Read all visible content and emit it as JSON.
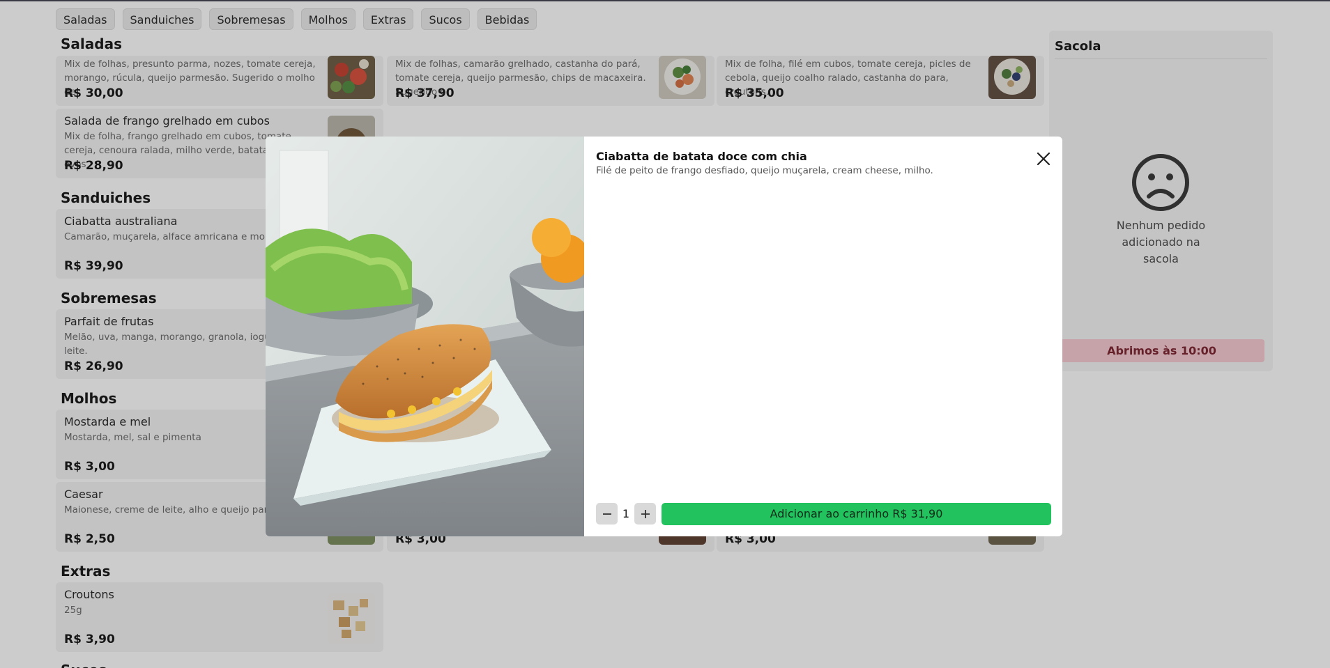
{
  "tabs": [
    "Saladas",
    "Sanduiches",
    "Sobremesas",
    "Molhos",
    "Extras",
    "Sucos",
    "Bebidas"
  ],
  "sections": {
    "saladas": "Saladas",
    "sanduiches": "Sanduiches",
    "sobremesas": "Sobremesas",
    "molhos": "Molhos",
    "extras": "Extras",
    "sucos": "Sucos"
  },
  "products": {
    "salada_parma": {
      "desc": "Mix de folhas, presunto parma, nozes, tomate cereja, morango, rúcula, queijo parmesão. Sugerido o molho de",
      "price": "R$ 30,00"
    },
    "salada_camarao": {
      "desc": "Mix de folhas, camarão grelhado, castanha do pará, tomate cereja, queijo parmesão, chips de macaxeira. Sugerido o",
      "price": "R$ 37,90"
    },
    "salada_file": {
      "desc": "Mix de folha, filé em cubos, tomate cereja, picles de cebola, queijo coalho ralado, castanha do para, croutons.",
      "price": "R$ 35,00"
    },
    "salada_frango": {
      "name": "Salada de frango grelhado em cubos",
      "desc": "Mix de folha, frango grelhado em cubos, tomate cereja, cenoura ralada, milho verde, batata palha, ovos",
      "price": "R$ 28,90"
    },
    "ciabatta_australiana": {
      "name": "Ciabatta australiana",
      "desc": "Camarão, muçarela, alface amricana e molho p",
      "price": "R$ 39,90"
    },
    "parfait": {
      "name": "Parfait de frutas",
      "desc": "Melão, uva, manga, morango, granola, iogurte de leite.",
      "price": "R$ 26,90"
    },
    "mostarda_mel": {
      "name": "Mostarda e mel",
      "desc": "Mostarda, mel, sal e pimenta",
      "price": "R$ 3,00"
    },
    "caesar": {
      "name": "Caesar",
      "desc": "Maionese, creme de leite, alho e queijo parmes",
      "price": "R$ 2,50"
    },
    "molho_2": {
      "price": "R$ 3,00"
    },
    "molho_3": {
      "price": "R$ 3,00"
    },
    "croutons": {
      "name": "Croutons",
      "desc": "25g",
      "price": "R$ 3,90"
    }
  },
  "bag": {
    "title": "Sacola",
    "empty_message": "Nenhum pedido adicionado na sacola",
    "closed_notice": "Abrimos às 10:00"
  },
  "modal": {
    "title": "Ciabatta de batata doce com chia",
    "description": "Filé de peito de frango desfiado, queijo muçarela, cream cheese, milho.",
    "quantity": "1",
    "add_button": "Adicionar ao carrinho R$ 31,90"
  },
  "colors": {
    "accent_green": "#22c35e",
    "closed_badge": "#f6c9cf"
  }
}
